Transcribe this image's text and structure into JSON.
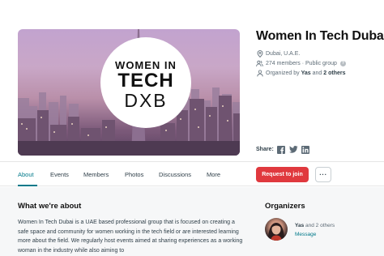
{
  "colors": {
    "accent_teal": "#00798a",
    "join_red": "#e0393e",
    "text_dark": "#111111",
    "text_body": "#2e3e48",
    "text_muted": "#5d6b76",
    "section_bg": "#f6f7f8"
  },
  "banner": {
    "logo_lines": [
      "WOMEN IN",
      "TECH",
      "DXB"
    ]
  },
  "group": {
    "title": "Women In Tech Dubai",
    "location": "Dubai, U.A.E.",
    "members_text": "274 members · Public group",
    "organized_prefix": "Organized by ",
    "organized_name": "Yas",
    "organized_mid": " and ",
    "organized_others": "2 others",
    "icons": {
      "location": "location-pin-icon",
      "members": "people-icon",
      "organizer": "person-icon",
      "help": "help-icon"
    }
  },
  "share": {
    "label": "Share:",
    "icons": [
      "facebook-icon",
      "twitter-icon",
      "linkedin-icon"
    ]
  },
  "nav": {
    "tabs": [
      "About",
      "Events",
      "Members",
      "Photos",
      "Discussions",
      "More"
    ],
    "active_tab": "About",
    "join_label": "Request to join",
    "more_label": "···"
  },
  "about": {
    "heading": "What we're about",
    "text": "Women In Tech Dubai is a UAE based professional group that is focused on creating a safe space and community for women working in the tech field or are interested learning more about the field. We regularly host events aimed at sharing experiences as a working woman in the industry while also aiming to"
  },
  "organizers": {
    "heading": "Organizers",
    "name": "Yas",
    "and_text": " and 2 others",
    "message_label": "Message"
  }
}
